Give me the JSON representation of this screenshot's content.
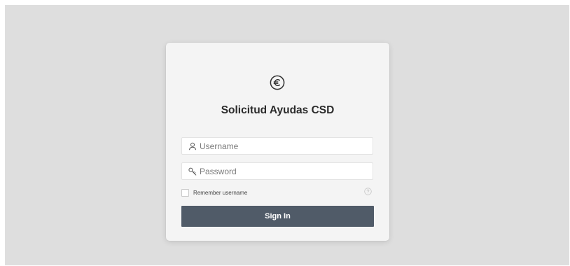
{
  "login": {
    "logo_icon": "euro-icon",
    "title": "Solicitud Ayudas CSD",
    "username": {
      "icon": "user-icon",
      "value": "",
      "placeholder": "Username"
    },
    "password": {
      "icon": "key-icon",
      "value": "",
      "placeholder": "Password"
    },
    "remember": {
      "label": "Remember username",
      "checked": false,
      "help_icon": "help-icon"
    },
    "signin_label": "Sign In"
  },
  "colors": {
    "backdrop": "#dedede",
    "card": "#f4f4f4",
    "button": "#505b68",
    "button_text": "#ffffff",
    "title_text": "#2b2b2b"
  }
}
